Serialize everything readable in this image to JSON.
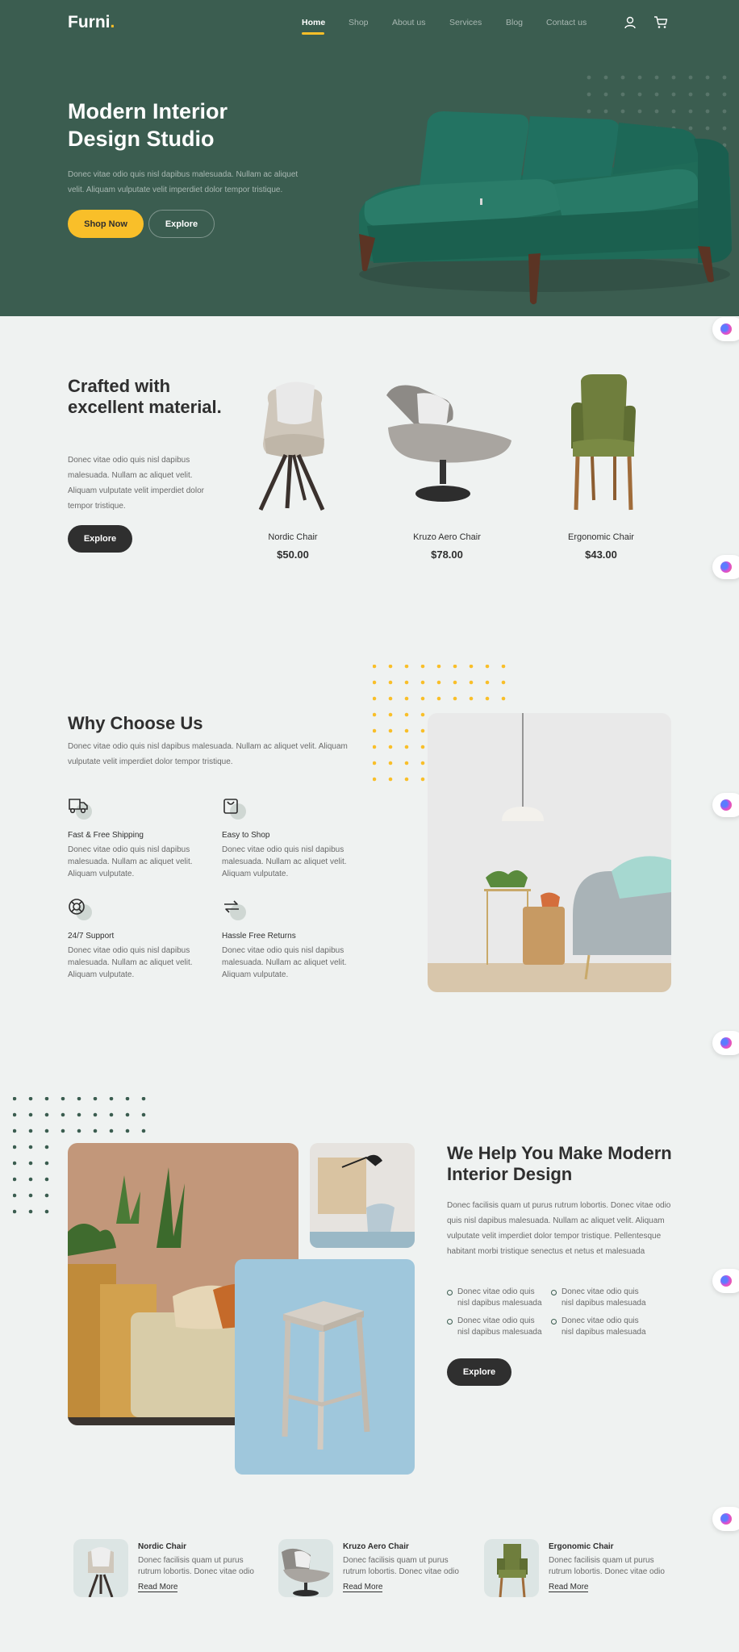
{
  "brand": {
    "name": "Furni",
    "dot": "."
  },
  "nav": {
    "items": [
      {
        "label": "Home",
        "active": true
      },
      {
        "label": "Shop",
        "active": false
      },
      {
        "label": "About us",
        "active": false
      },
      {
        "label": "Services",
        "active": false
      },
      {
        "label": "Blog",
        "active": false
      },
      {
        "label": "Contact us",
        "active": false
      }
    ],
    "icons": [
      "user-icon",
      "cart-icon"
    ]
  },
  "hero": {
    "title": "Modern Interior Design Studio",
    "description": "Donec vitae odio quis nisl dapibus malesuada. Nullam ac aliquet velit. Aliquam vulputate velit imperdiet dolor tempor tristique.",
    "primary_button": "Shop Now",
    "secondary_button": "Explore"
  },
  "crafted": {
    "title": "Crafted with excellent material.",
    "description": "Donec vitae odio quis nisl dapibus malesuada. Nullam ac aliquet velit. Aliquam vulputate velit imperdiet dolor tempor tristique.",
    "button": "Explore",
    "products": [
      {
        "name": "Nordic Chair",
        "price": "$50.00"
      },
      {
        "name": "Kruzo Aero Chair",
        "price": "$78.00"
      },
      {
        "name": "Ergonomic Chair",
        "price": "$43.00"
      }
    ]
  },
  "why": {
    "title": "Why Choose Us",
    "description": "Donec vitae odio quis nisl dapibus malesuada. Nullam ac aliquet velit. Aliquam vulputate velit imperdiet dolor tempor tristique.",
    "features": [
      {
        "icon": "truck-icon",
        "title": "Fast & Free Shipping",
        "description": "Donec vitae odio quis nisl dapibus malesuada. Nullam ac aliquet velit. Aliquam vulputate."
      },
      {
        "icon": "bag-icon",
        "title": "Easy to Shop",
        "description": "Donec vitae odio quis nisl dapibus malesuada. Nullam ac aliquet velit. Aliquam vulputate."
      },
      {
        "icon": "support-icon",
        "title": "24/7 Support",
        "description": "Donec vitae odio quis nisl dapibus malesuada. Nullam ac aliquet velit. Aliquam vulputate."
      },
      {
        "icon": "return-icon",
        "title": "Hassle Free Returns",
        "description": "Donec vitae odio quis nisl dapibus malesuada. Nullam ac aliquet velit. Aliquam vulputate."
      }
    ]
  },
  "help": {
    "title": "We Help You Make Modern Interior Design",
    "description": "Donec facilisis quam ut purus rutrum lobortis. Donec vitae odio quis nisl dapibus malesuada. Nullam ac aliquet velit. Aliquam vulputate velit imperdiet dolor tempor tristique. Pellentesque habitant morbi tristique senectus et netus et malesuada",
    "bullets": [
      "Donec vitae odio quis nisl dapibus malesuada",
      "Donec vitae odio quis nisl dapibus malesuada",
      "Donec vitae odio quis nisl dapibus malesuada",
      "Donec vitae odio quis nisl dapibus malesuada"
    ],
    "button": "Explore"
  },
  "mini_products": [
    {
      "name": "Nordic Chair",
      "description": "Donec facilisis quam ut purus rutrum lobortis. Donec vitae odio",
      "link": "Read More"
    },
    {
      "name": "Kruzo Aero Chair",
      "description": "Donec facilisis quam ut purus rutrum lobortis. Donec vitae odio",
      "link": "Read More"
    },
    {
      "name": "Ergonomic Chair",
      "description": "Donec facilisis quam ut purus rutrum lobortis. Donec vitae odio",
      "link": "Read More"
    }
  ],
  "colors": {
    "primary_green": "#3b5d50",
    "accent_yellow": "#f9bf29",
    "dark": "#2f2f2f",
    "background": "#eff2f1"
  }
}
